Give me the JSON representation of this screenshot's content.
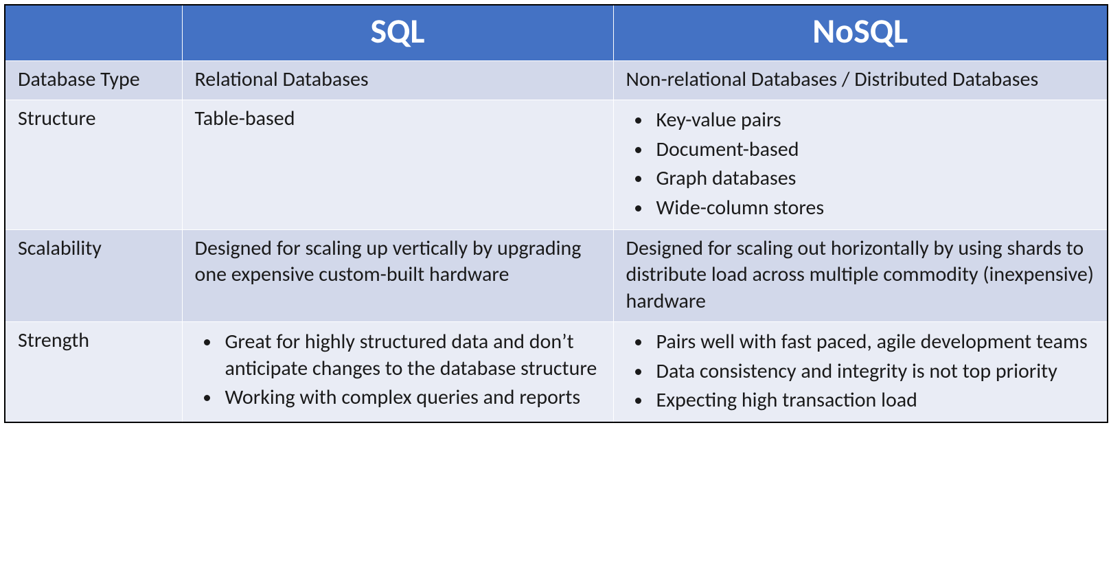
{
  "chart_data": {
    "type": "table",
    "columns": [
      "",
      "SQL",
      "NoSQL"
    ],
    "rows": [
      {
        "label": "Database Type",
        "sql": "Relational Databases",
        "nosql": "Non-relational Databases / Distributed Databases"
      },
      {
        "label": "Structure",
        "sql": "Table-based",
        "nosql": [
          "Key-value pairs",
          "Document-based",
          "Graph databases",
          "Wide-column stores"
        ]
      },
      {
        "label": "Scalability",
        "sql": "Designed for scaling up vertically by upgrading one expensive custom-built hardware",
        "nosql": "Designed for scaling out horizontally by using shards to distribute load across multiple commodity (inexpensive) hardware"
      },
      {
        "label": "Strength",
        "sql": [
          "Great for highly structured data and don’t anticipate changes to the database structure",
          "Working with complex queries and reports"
        ],
        "nosql": [
          "Pairs well with fast paced, agile development teams",
          "Data consistency and integrity is not top priority",
          "Expecting high transaction load"
        ]
      }
    ]
  },
  "headers": {
    "blank": "",
    "sql": "SQL",
    "nosql": "NoSQL"
  },
  "rows": {
    "dbtype": {
      "label": "Database Type",
      "sql": "Relational Databases",
      "nosql": "Non-relational Databases / Distributed Databases"
    },
    "structure": {
      "label": "Structure",
      "sql": "Table-based",
      "nosql_items": {
        "0": "Key-value pairs",
        "1": "Document-based",
        "2": "Graph databases",
        "3": "Wide-column stores"
      }
    },
    "scalability": {
      "label": "Scalability",
      "sql": "Designed for scaling up vertically by upgrading one expensive custom-built hardware",
      "nosql": "Designed for scaling out horizontally by using shards to distribute load across multiple commodity (inexpensive) hardware"
    },
    "strength": {
      "label": "Strength",
      "sql_items": {
        "0": "Great for highly structured data and don’t anticipate changes to the database structure",
        "1": "Working with complex queries and reports"
      },
      "nosql_items": {
        "0": "Pairs well with fast paced, agile development teams",
        "1": "Data consistency and integrity is not top priority",
        "2": "Expecting high transaction load"
      }
    }
  },
  "colors": {
    "header_bg": "#4472c4",
    "band_a": "#d2d8ea",
    "band_b": "#e9ecf5"
  }
}
